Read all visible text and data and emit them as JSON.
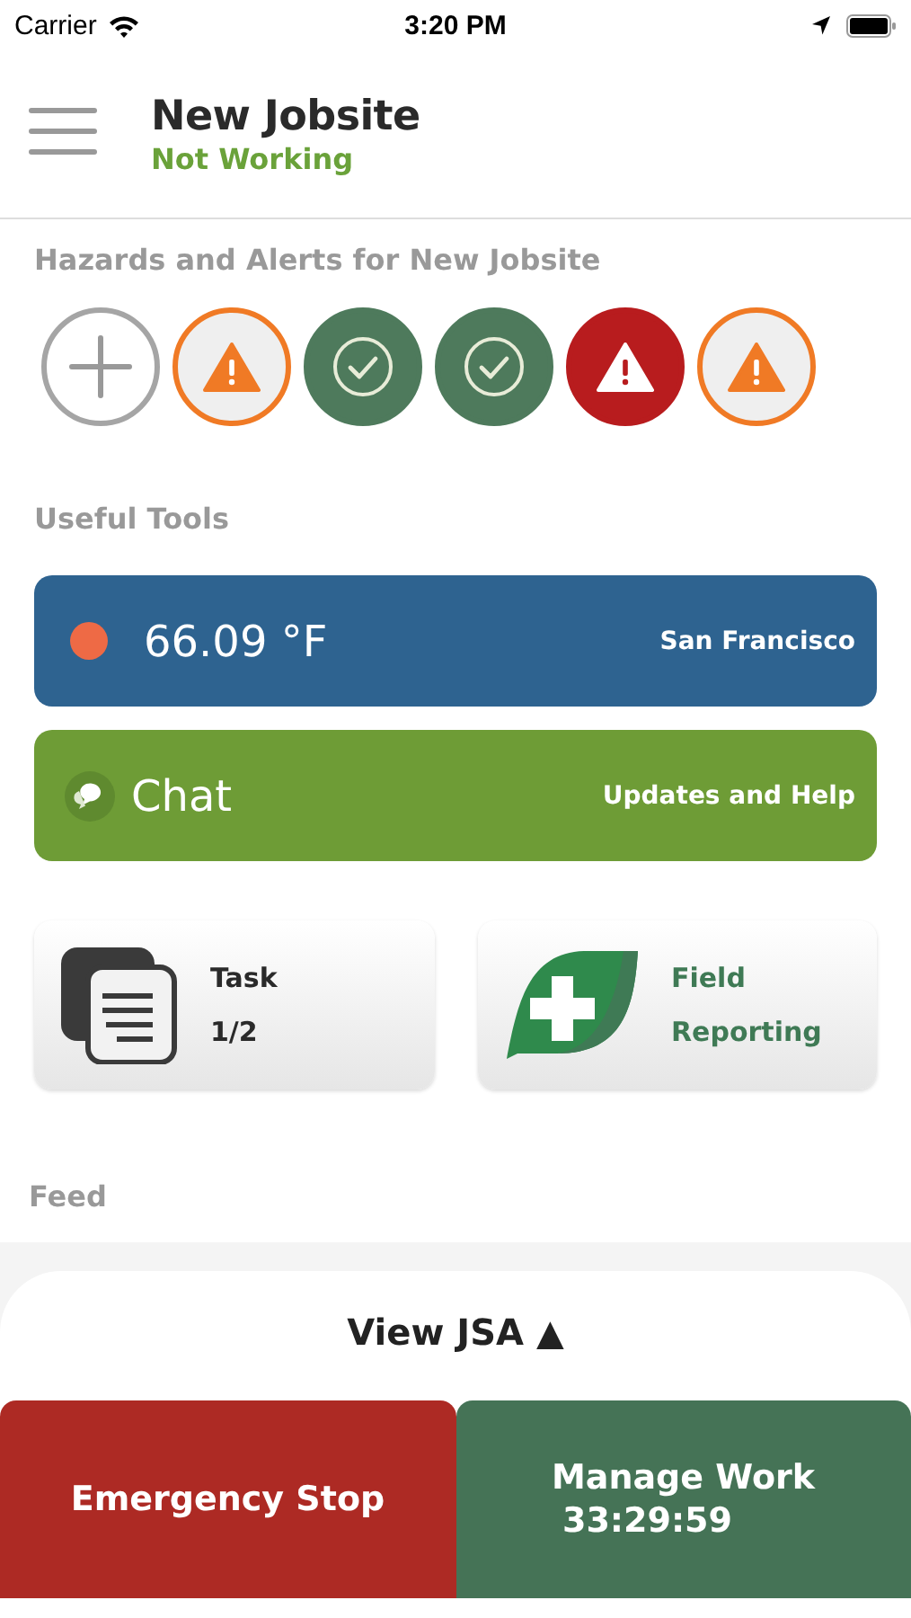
{
  "status_bar": {
    "carrier": "Carrier",
    "time": "3:20 PM"
  },
  "header": {
    "title": "New Jobsite",
    "status": "Not Working"
  },
  "hazards": {
    "title": "Hazards and Alerts for New Jobsite",
    "items": [
      {
        "kind": "add"
      },
      {
        "kind": "warning"
      },
      {
        "kind": "check"
      },
      {
        "kind": "check"
      },
      {
        "kind": "alert"
      },
      {
        "kind": "warning"
      }
    ]
  },
  "tools": {
    "title": "Useful Tools",
    "weather": {
      "temperature": "66.09 °F",
      "location": "San Francisco",
      "color": "#ee6a45"
    },
    "chat": {
      "label": "Chat",
      "caption": "Updates and Help"
    },
    "tiles": [
      {
        "kind": "task",
        "label": "Task",
        "detail": "1/2"
      },
      {
        "kind": "report",
        "label": "Field Reporting"
      }
    ]
  },
  "feed": {
    "title": "Feed"
  },
  "sheet": {
    "label": "View JSA ▲"
  },
  "actions": [
    {
      "kind": "stop",
      "label": "Emergency Stop"
    },
    {
      "kind": "work",
      "label": "Manage Work",
      "detail": "33:29:59"
    }
  ]
}
